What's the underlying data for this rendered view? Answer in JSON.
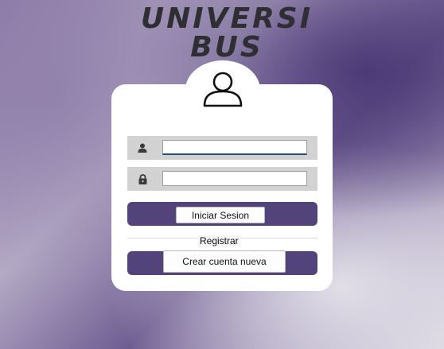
{
  "logo": {
    "line1": "UNIVERSI",
    "line2": "BUS"
  },
  "form": {
    "username": {
      "value": "",
      "icon": "user-icon"
    },
    "password": {
      "value": "",
      "icon": "lock-icon"
    },
    "login_label": "Iniciar Sesion",
    "register_label": "Registrar",
    "create_account_label": "Crear cuenta nueva"
  },
  "colors": {
    "accent": "#52437a",
    "logo": "#2e2e33",
    "field_bg": "#d2d2d2"
  }
}
